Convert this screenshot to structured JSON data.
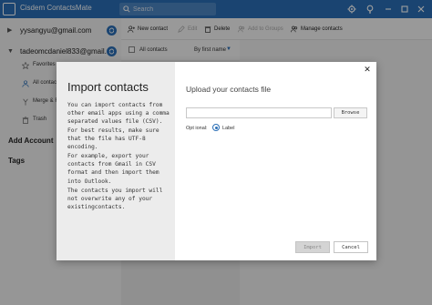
{
  "app": {
    "title": "Cisdem ContactsMate"
  },
  "search": {
    "placeholder": "Search"
  },
  "colors": {
    "accent": "#2b6fb6",
    "overlay": "rgba(0,0,0,0.38)"
  },
  "sidebar": {
    "accounts": [
      {
        "email": "yysangyu@gmail.com",
        "expanded": false
      },
      {
        "email": "tadeomcdaniel833@gmail....",
        "expanded": true
      }
    ],
    "items": [
      {
        "label": "Favorites",
        "icon": "star-icon"
      },
      {
        "label": "All contacts",
        "icon": "contacts-icon"
      },
      {
        "label": "Merge & Fix",
        "icon": "merge-icon"
      },
      {
        "label": "Trash",
        "icon": "trash-icon"
      }
    ],
    "add_account": "Add Account",
    "tags": "Tags"
  },
  "toolbar": {
    "new_contact": "New contact",
    "edit": "Edit",
    "delete": "Delete",
    "add_to_groups": "Add to Groups",
    "manage_contacts": "Manage contacts"
  },
  "list": {
    "all_contacts": "All contacts",
    "sort": "By first name"
  },
  "modal": {
    "title": "Import contacts",
    "para1": "You can import contacts from other email apps using a comma separated values file (CSV). For best results, make sure that the file has UTF-8 encoding.",
    "para2": "For example, export your contacts from Gmail in CSV format and then import them into Outlook.",
    "para3": "The contacts you import will not overwrite any of your existingcontacts.",
    "upload_title": "Upload your contacts file",
    "browse": "Browse",
    "option_label": "Opt ional:",
    "radio_label": "Label",
    "import": "Import",
    "cancel": "Cancel"
  }
}
